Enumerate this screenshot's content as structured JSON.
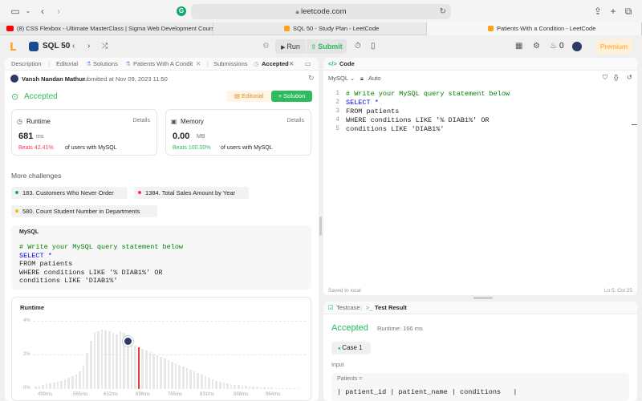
{
  "browser": {
    "url": "leetcode.com",
    "tabs": [
      {
        "label": "(8) CSS Flexbox - Ultimate MasterClass | Sigma Web Development Course - Tu..."
      },
      {
        "label": "SQL 50 - Study Plan - LeetCode"
      },
      {
        "label": "Patients With a Condition - LeetCode"
      }
    ]
  },
  "header": {
    "study_plan": "SQL 50",
    "run_label": "Run",
    "submit_label": "Submit",
    "streak": "0",
    "premium_label": "Premium"
  },
  "left_tabs": [
    {
      "label": "Description"
    },
    {
      "label": "Editorial"
    },
    {
      "label": "Solutions"
    },
    {
      "label": "Patients With A Conditi"
    },
    {
      "label": "Submissions"
    },
    {
      "label": "Accepted"
    }
  ],
  "submission": {
    "user": "Vansh Nandan Mathur",
    "submitted_text": "submitted at Nov 09, 2023 11:50",
    "status": "Accepted",
    "editorial_label": "Editorial",
    "solution_label": "+ Solution",
    "runtime": {
      "title": "Runtime",
      "details": "Details",
      "value": "681",
      "unit": "ms",
      "beats_pct": "Beats 42.41%",
      "beats_rest": "of users with MySQL"
    },
    "memory": {
      "title": "Memory",
      "details": "Details",
      "value": "0.00",
      "unit": "MB",
      "beats_pct": "Beats 100.00%",
      "beats_rest": "of users with MySQL"
    }
  },
  "more_challenges": {
    "title": "More challenges",
    "items": [
      {
        "label": "183. Customers Who Never Order",
        "color": "#00af9b"
      },
      {
        "label": "1384. Total Sales Amount by Year",
        "color": "#ff2d55"
      },
      {
        "label": "580. Count Student Number in Departments",
        "color": "#ffb800"
      }
    ]
  },
  "code_block": {
    "language": "MySQL",
    "lines": [
      "# Write your MySQL query statement below",
      "SELECT *",
      "FROM patients",
      "WHERE conditions LIKE '% DIAB1%' OR",
      "conditions LIKE 'DIAB1%'"
    ]
  },
  "runtime_chart": {
    "title": "Runtime",
    "y_ticks": [
      "4%",
      "2%",
      "0%"
    ],
    "x_ticks": [
      "499ms",
      "565ms",
      "632ms",
      "698ms",
      "765ms",
      "831ms",
      "898ms",
      "964ms"
    ]
  },
  "editor": {
    "title": "Code",
    "language": "MySQL",
    "auto_label": "Auto",
    "line_numbers": [
      "1",
      "2",
      "3",
      "4",
      "5"
    ],
    "saved_text": "Saved to local",
    "cursor_pos": "Ln 5, Col 25"
  },
  "testcase": {
    "tab_testcase": "Testcase",
    "tab_result": "Test Result",
    "status": "Accepted",
    "runtime_text": "Runtime: 166 ms",
    "case_label": "Case 1",
    "input_label": "Input",
    "var_label": "Patients =",
    "table_header": "| patient_id | patient_name | conditions   |"
  },
  "colors": {
    "accent_green": "#2cbb5d",
    "accent_orange": "#ffa116",
    "beats_red": "#ff375f",
    "beats_green": "#2cbb5d"
  }
}
